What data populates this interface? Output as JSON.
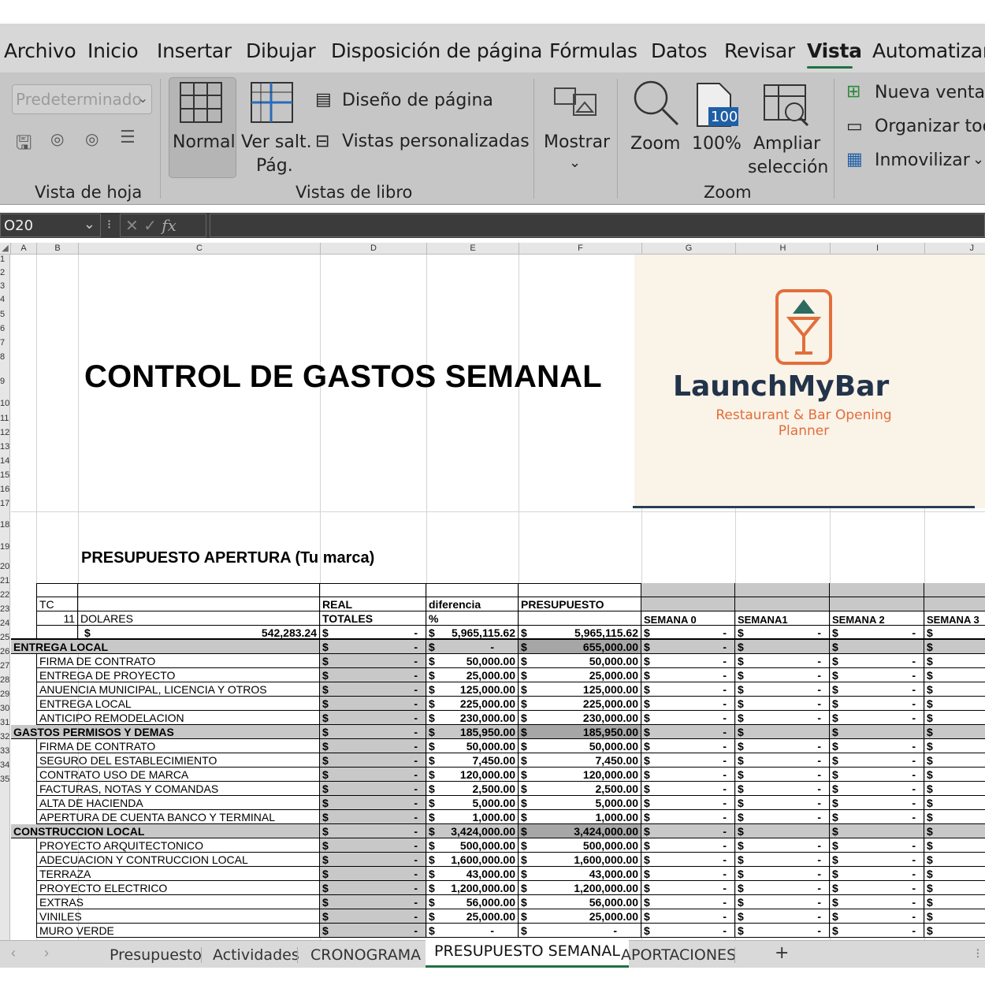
{
  "menu": {
    "items": [
      "Archivo",
      "Inicio",
      "Insertar",
      "Dibujar",
      "Disposición de página",
      "Fórmulas",
      "Datos",
      "Revisar",
      "Vista",
      "Automatizar"
    ],
    "active": "Vista"
  },
  "ribbon": {
    "sheet_view_combo": "Predeterminado",
    "group_sheet_view": "Vista de hoja",
    "normal": "Normal",
    "page_break_line1": "Ver salt.",
    "page_break_line2": "Pág.",
    "page_layout": "Diseño de página",
    "custom_views": "Vistas personalizadas",
    "group_workbook_views": "Vistas de libro",
    "show": "Mostrar",
    "zoom": "Zoom",
    "zoom100": "100%",
    "zoom100_badge": "100",
    "zoom_selection_line1": "Ampliar",
    "zoom_selection_line2": "selección",
    "group_zoom": "Zoom",
    "new_window": "Nueva ventana",
    "arrange_all": "Organizar todo",
    "freeze": "Inmovilizar"
  },
  "formula_bar": {
    "cell_ref": "O20",
    "fx": "fx"
  },
  "columns": [
    "A",
    "B",
    "C",
    "D",
    "E",
    "F",
    "G",
    "H",
    "I",
    "J"
  ],
  "rows": [
    "1",
    "2",
    "3",
    "4",
    "5",
    "6",
    "7",
    "8",
    "9",
    "10",
    "11",
    "12",
    "13",
    "14",
    "15",
    "16",
    "17",
    "18",
    "19",
    "20",
    "21",
    "22",
    "23",
    "24",
    "25",
    "26",
    "27",
    "28",
    "29",
    "30",
    "31",
    "32",
    "33",
    "34",
    "35"
  ],
  "sheet": {
    "title": "CONTROL DE GASTOS SEMANAL",
    "subtitle": "PRESUPUESTO APERTURA (Tu marca)",
    "logo_name": "LaunchMyBar",
    "logo_tagline": "Restaurant & Bar Opening Planner",
    "header": {
      "tc": "TC",
      "tc_value": "11",
      "dolares": "DOLARES",
      "real": "REAL",
      "totales": "TOTALES",
      "diferencia": "diferencia",
      "pct": "%",
      "presupuesto": "PRESUPUESTO",
      "weeks": [
        "SEMANA 0",
        "SEMANA1",
        "SEMANA 2",
        "SEMANA 3"
      ],
      "total_dolares": "542,283.24",
      "total_diferencia": "5,965,115.62",
      "total_presupuesto": "5,965,115.62"
    },
    "dollar": "$",
    "dash": "-",
    "items": [
      {
        "label": "ENTREGA LOCAL",
        "type": "section",
        "dif": "-",
        "pres": "655,000.00"
      },
      {
        "label": "FIRMA DE CONTRATO",
        "type": "item",
        "dif": "50,000.00",
        "pres": "50,000.00"
      },
      {
        "label": "ENTREGA DE PROYECTO",
        "type": "item",
        "dif": "25,000.00",
        "pres": "25,000.00"
      },
      {
        "label": "ANUENCIA MUNICIPAL, LICENCIA Y OTROS",
        "type": "item",
        "dif": "125,000.00",
        "pres": "125,000.00"
      },
      {
        "label": "ENTREGA LOCAL",
        "type": "item",
        "dif": "225,000.00",
        "pres": "225,000.00"
      },
      {
        "label": "ANTICIPO REMODELACION",
        "type": "item",
        "dif": "230,000.00",
        "pres": "230,000.00"
      },
      {
        "label": "GASTOS PERMISOS Y DEMAS",
        "type": "section",
        "dif": "185,950.00",
        "pres": "185,950.00"
      },
      {
        "label": "FIRMA DE CONTRATO",
        "type": "item",
        "dif": "50,000.00",
        "pres": "50,000.00"
      },
      {
        "label": "SEGURO DEL ESTABLECIMIENTO",
        "type": "item",
        "dif": "7,450.00",
        "pres": "7,450.00"
      },
      {
        "label": "CONTRATO USO DE MARCA",
        "type": "item",
        "dif": "120,000.00",
        "pres": "120,000.00"
      },
      {
        "label": "FACTURAS, NOTAS Y COMANDAS",
        "type": "item",
        "dif": "2,500.00",
        "pres": "2,500.00"
      },
      {
        "label": "ALTA DE HACIENDA",
        "type": "item",
        "dif": "5,000.00",
        "pres": "5,000.00"
      },
      {
        "label": "APERTURA DE CUENTA BANCO Y TERMINAL",
        "type": "item",
        "dif": "1,000.00",
        "pres": "1,000.00"
      },
      {
        "label": "CONSTRUCCION LOCAL",
        "type": "section",
        "dif": "3,424,000.00",
        "pres": "3,424,000.00"
      },
      {
        "label": "PROYECTO ARQUITECTONICO",
        "type": "item",
        "dif": "500,000.00",
        "pres": "500,000.00"
      },
      {
        "label": "ADECUACION Y CONTRUCCION LOCAL",
        "type": "item",
        "dif": "1,600,000.00",
        "pres": "1,600,000.00"
      },
      {
        "label": "TERRAZA",
        "type": "item",
        "dif": "43,000.00",
        "pres": "43,000.00"
      },
      {
        "label": "PROYECTO ELECTRICO",
        "type": "item",
        "dif": "1,200,000.00",
        "pres": "1,200,000.00"
      },
      {
        "label": "EXTRAS",
        "type": "item",
        "dif": "56,000.00",
        "pres": "56,000.00"
      },
      {
        "label": "VINILES",
        "type": "item",
        "dif": "25,000.00",
        "pres": "25,000.00"
      },
      {
        "label": "MURO VERDE",
        "type": "item",
        "dif": "-",
        "pres": "-"
      }
    ]
  },
  "tabs": [
    "Presupuesto",
    "Actividades",
    "CRONOGRAMA",
    "PRESUPUESTO SEMANAL",
    "APORTACIONES"
  ],
  "active_tab": "PRESUPUESTO SEMANAL",
  "add_sheet": "+",
  "colors": {
    "accent": "#1e7145",
    "logo_navy": "#22334a",
    "logo_orange": "#e26e3c",
    "logo_teal": "#2e6b5e"
  }
}
